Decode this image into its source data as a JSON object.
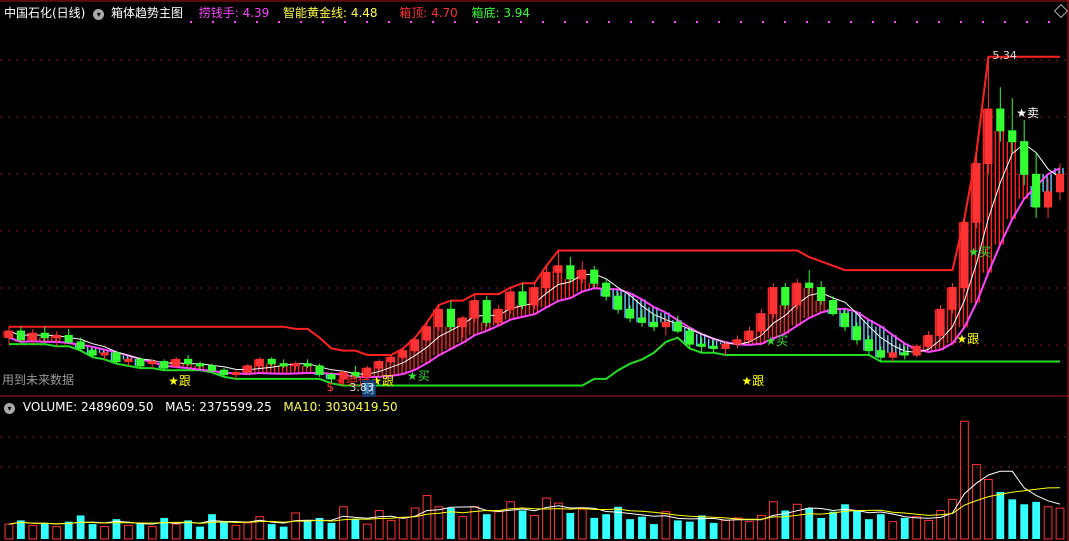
{
  "header": {
    "stock_name": "中国石化(日线)",
    "indicator_name": "箱体趋势主图",
    "items": [
      {
        "label": "捞钱手",
        "value": "4.39",
        "color": "#ff44ff"
      },
      {
        "label": "智能黄金线",
        "value": "4.48",
        "color": "#ffff44"
      },
      {
        "label": "箱顶",
        "value": "4.70",
        "color": "#ff3333"
      },
      {
        "label": "箱底",
        "value": "3.94",
        "color": "#33ff33"
      }
    ]
  },
  "main_panel": {
    "note": "用到未来数据",
    "high_label": "5.34",
    "low_label": "3.83",
    "signals": [
      {
        "text": "★跟",
        "color": "#ffff00",
        "day": 14
      },
      {
        "text": "★绝佳",
        "color": "#ff2222",
        "day": 28
      },
      {
        "text": "★买",
        "color": "#33dd33",
        "day": 34
      },
      {
        "text": "★跟",
        "color": "#ffff00",
        "day": 31
      },
      {
        "text": "★买",
        "color": "#33dd33",
        "day": 64
      },
      {
        "text": "★跟",
        "color": "#ffff00",
        "day": 62
      },
      {
        "text": "★跟",
        "color": "#ffff00",
        "day": 80
      },
      {
        "text": "★买",
        "color": "#33dd33",
        "day": 81
      },
      {
        "text": "★卖",
        "color": "#ffffff",
        "day": 85
      }
    ],
    "badges": [
      {
        "text": "$",
        "color": "#ff3333",
        "day": 27
      },
      {
        "text": "财",
        "color": "#66ccff",
        "day": 30
      }
    ]
  },
  "volume_header": {
    "volume_label": "VOLUME",
    "volume_value": "2489609.50",
    "ma5_label": "MA5",
    "ma5_value": "2375599.25",
    "ma10_label": "MA10",
    "ma10_value": "3030419.50"
  },
  "chart_data": [
    {
      "type": "candlestick",
      "days": 89,
      "ylim": [
        3.8,
        5.5
      ],
      "candles": [
        [
          4.05,
          4.1,
          4.02,
          4.08
        ],
        [
          4.08,
          4.1,
          4.03,
          4.04
        ],
        [
          4.04,
          4.09,
          4.02,
          4.07
        ],
        [
          4.07,
          4.1,
          4.03,
          4.05
        ],
        [
          4.05,
          4.08,
          4.01,
          4.06
        ],
        [
          4.06,
          4.09,
          4.02,
          4.03
        ],
        [
          4.03,
          4.05,
          3.99,
          4.0
        ],
        [
          3.99,
          4.0,
          3.96,
          3.97
        ],
        [
          3.97,
          3.99,
          3.95,
          3.98
        ],
        [
          3.98,
          3.99,
          3.93,
          3.94
        ],
        [
          3.94,
          3.96,
          3.92,
          3.95
        ],
        [
          3.95,
          3.96,
          3.91,
          3.92
        ],
        [
          3.93,
          3.95,
          3.91,
          3.94
        ],
        [
          3.94,
          3.95,
          3.9,
          3.91
        ],
        [
          3.92,
          3.96,
          3.91,
          3.95
        ],
        [
          3.95,
          3.97,
          3.92,
          3.93
        ],
        [
          3.93,
          3.94,
          3.9,
          3.92
        ],
        [
          3.92,
          3.93,
          3.89,
          3.9
        ],
        [
          3.9,
          3.91,
          3.87,
          3.88
        ],
        [
          3.88,
          3.9,
          3.86,
          3.89
        ],
        [
          3.89,
          3.93,
          3.88,
          3.92
        ],
        [
          3.92,
          3.96,
          3.91,
          3.95
        ],
        [
          3.95,
          3.96,
          3.92,
          3.93
        ],
        [
          3.93,
          3.95,
          3.91,
          3.92
        ],
        [
          3.92,
          3.94,
          3.9,
          3.93
        ],
        [
          3.93,
          3.95,
          3.91,
          3.92
        ],
        [
          3.92,
          3.93,
          3.87,
          3.88
        ],
        [
          3.88,
          3.89,
          3.84,
          3.86
        ],
        [
          3.86,
          3.9,
          3.83,
          3.89
        ],
        [
          3.89,
          3.92,
          3.86,
          3.87
        ],
        [
          3.87,
          3.92,
          3.86,
          3.91
        ],
        [
          3.91,
          3.95,
          3.9,
          3.94
        ],
        [
          3.94,
          3.97,
          3.93,
          3.96
        ],
        [
          3.96,
          4.0,
          3.95,
          3.99
        ],
        [
          3.99,
          4.05,
          3.98,
          4.04
        ],
        [
          4.04,
          4.12,
          4.03,
          4.1
        ],
        [
          4.1,
          4.2,
          4.08,
          4.18
        ],
        [
          4.18,
          4.22,
          4.08,
          4.1
        ],
        [
          4.1,
          4.15,
          4.05,
          4.14
        ],
        [
          4.14,
          4.25,
          4.12,
          4.22
        ],
        [
          4.22,
          4.24,
          4.1,
          4.12
        ],
        [
          4.12,
          4.2,
          4.1,
          4.18
        ],
        [
          4.18,
          4.28,
          4.16,
          4.26
        ],
        [
          4.26,
          4.3,
          4.18,
          4.2
        ],
        [
          4.2,
          4.3,
          4.18,
          4.28
        ],
        [
          4.28,
          4.38,
          4.26,
          4.35
        ],
        [
          4.35,
          4.45,
          4.3,
          4.38
        ],
        [
          4.38,
          4.42,
          4.3,
          4.32
        ],
        [
          4.32,
          4.4,
          4.3,
          4.36
        ],
        [
          4.36,
          4.38,
          4.28,
          4.3
        ],
        [
          4.3,
          4.32,
          4.22,
          4.24
        ],
        [
          4.24,
          4.26,
          4.16,
          4.18
        ],
        [
          4.18,
          4.2,
          4.12,
          4.14
        ],
        [
          4.14,
          4.18,
          4.1,
          4.12
        ],
        [
          4.12,
          4.16,
          4.08,
          4.1
        ],
        [
          4.1,
          4.14,
          4.06,
          4.12
        ],
        [
          4.12,
          4.15,
          4.07,
          4.08
        ],
        [
          4.08,
          4.1,
          4.0,
          4.02
        ],
        [
          4.02,
          4.05,
          3.98,
          4.01
        ],
        [
          4.01,
          4.04,
          3.98,
          4.0
        ],
        [
          4.0,
          4.03,
          3.97,
          4.02
        ],
        [
          4.02,
          4.06,
          4.0,
          4.04
        ],
        [
          4.04,
          4.1,
          4.03,
          4.08
        ],
        [
          4.08,
          4.18,
          4.06,
          4.16
        ],
        [
          4.16,
          4.3,
          4.14,
          4.28
        ],
        [
          4.28,
          4.3,
          4.18,
          4.2
        ],
        [
          4.2,
          4.32,
          4.18,
          4.3
        ],
        [
          4.3,
          4.36,
          4.25,
          4.28
        ],
        [
          4.28,
          4.31,
          4.2,
          4.22
        ],
        [
          4.22,
          4.24,
          4.15,
          4.16
        ],
        [
          4.16,
          4.18,
          4.08,
          4.1
        ],
        [
          4.1,
          4.12,
          4.02,
          4.04
        ],
        [
          4.04,
          4.06,
          3.97,
          3.99
        ],
        [
          3.99,
          4.01,
          3.94,
          3.96
        ],
        [
          3.96,
          4.0,
          3.94,
          3.98
        ],
        [
          3.98,
          4.01,
          3.95,
          3.97
        ],
        [
          3.97,
          4.02,
          3.96,
          4.01
        ],
        [
          4.01,
          4.08,
          4.0,
          4.06
        ],
        [
          4.06,
          4.2,
          4.04,
          4.18
        ],
        [
          4.18,
          4.3,
          4.16,
          4.28
        ],
        [
          4.28,
          4.6,
          4.26,
          4.58
        ],
        [
          4.58,
          4.9,
          4.55,
          4.85
        ],
        [
          4.85,
          5.34,
          4.8,
          5.1
        ],
        [
          5.1,
          5.2,
          4.95,
          5.0
        ],
        [
          5.0,
          5.15,
          4.9,
          4.95
        ],
        [
          4.95,
          5.05,
          4.75,
          4.8
        ],
        [
          4.8,
          4.9,
          4.6,
          4.65
        ],
        [
          4.65,
          4.78,
          4.6,
          4.72
        ],
        [
          4.72,
          4.85,
          4.68,
          4.8
        ]
      ]
    },
    {
      "type": "bar",
      "ylim": [
        0,
        10000000
      ],
      "values": [
        1200000,
        1500000,
        1100000,
        1300000,
        1000000,
        1400000,
        1900000,
        1200000,
        1000000,
        1600000,
        1100000,
        1300000,
        1000000,
        1700000,
        1200000,
        1500000,
        1000000,
        2000000,
        1400000,
        1100000,
        1300000,
        1800000,
        1200000,
        1000000,
        2100000,
        1500000,
        1700000,
        1300000,
        2600000,
        1600000,
        1200000,
        2300000,
        1500000,
        1700000,
        2500000,
        3500000,
        2600000,
        2500000,
        1800000,
        2600000,
        2000000,
        2200000,
        3000000,
        2300000,
        1900000,
        3300000,
        2900000,
        2100000,
        2400000,
        1700000,
        2000000,
        2600000,
        1600000,
        1800000,
        1200000,
        2200000,
        1500000,
        1400000,
        1900000,
        1300000,
        1500000,
        1700000,
        1400000,
        1900000,
        3000000,
        2300000,
        2800000,
        2500000,
        1700000,
        2200000,
        2800000,
        2300000,
        1600000,
        2000000,
        1400000,
        1700000,
        1800000,
        1500000,
        2300000,
        3200000,
        9500000,
        6000000,
        4800000,
        3800000,
        3200000,
        2800000,
        3000000,
        2600000,
        2489609
      ],
      "ma5": [
        2375599.25
      ],
      "ma10": [
        3030419.5
      ]
    }
  ],
  "colors": {
    "up": "#ff3333",
    "down": "#33ffff",
    "box_top": "#ff2222",
    "box_bottom": "#22dd22",
    "money_hand": "#ff44ff",
    "ma_white": "#ffffff",
    "vol_ma5": "#ffffff",
    "vol_ma10": "#ffff00",
    "grid": "#8a1a1a",
    "frame": "#b01818"
  }
}
